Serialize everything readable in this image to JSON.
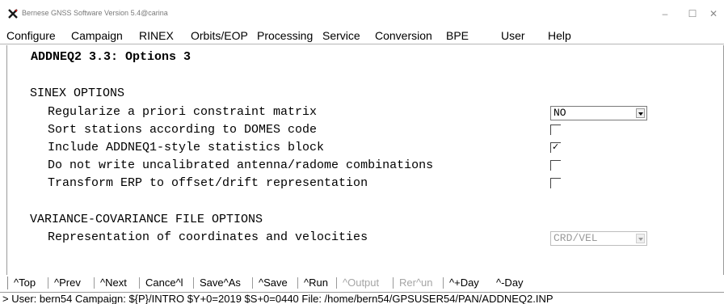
{
  "window": {
    "title": "Bernese GNSS Software Version 5.4@carina",
    "controls": {
      "minimize": "–",
      "maximize": "☐",
      "close": "✕"
    }
  },
  "menu": [
    "Configure",
    "Campaign",
    "RINEX",
    "Orbits/EOP",
    "Processing",
    "Service",
    "Conversion",
    "BPE",
    "User",
    "Help"
  ],
  "panel": {
    "title": "ADDNEQ2 3.3: Options 3",
    "sinex": {
      "heading": "SINEX OPTIONS",
      "options": [
        {
          "label": "Regularize a priori constraint matrix",
          "control": "select",
          "value": "NO"
        },
        {
          "label": "Sort stations according to DOMES code",
          "control": "checkbox",
          "checked": false
        },
        {
          "label": "Include ADDNEQ1-style statistics block",
          "control": "checkbox",
          "checked": true
        },
        {
          "label": "Do not write uncalibrated antenna/radome combinations",
          "control": "checkbox",
          "checked": false
        },
        {
          "label": "Transform ERP to offset/drift representation",
          "control": "checkbox",
          "checked": false
        }
      ]
    },
    "varcov": {
      "heading": "VARIANCE-COVARIANCE FILE OPTIONS",
      "options": [
        {
          "label": "Representation of coordinates and velocities",
          "control": "select",
          "value": "CRD/VEL",
          "disabled": true
        }
      ]
    }
  },
  "toolbar": [
    "^Top",
    "^Prev",
    "^Next",
    "Cance^l",
    "Save^As",
    "^Save",
    "^Run",
    "^Output",
    "Rer^un",
    "^+Day",
    "^-Day"
  ],
  "status": "> User: bern54  Campaign: ${P}/INTRO  $Y+0=2019  $S+0=0440  File: /home/bern54/GPSUSER54/PAN/ADDNEQ2.INP"
}
